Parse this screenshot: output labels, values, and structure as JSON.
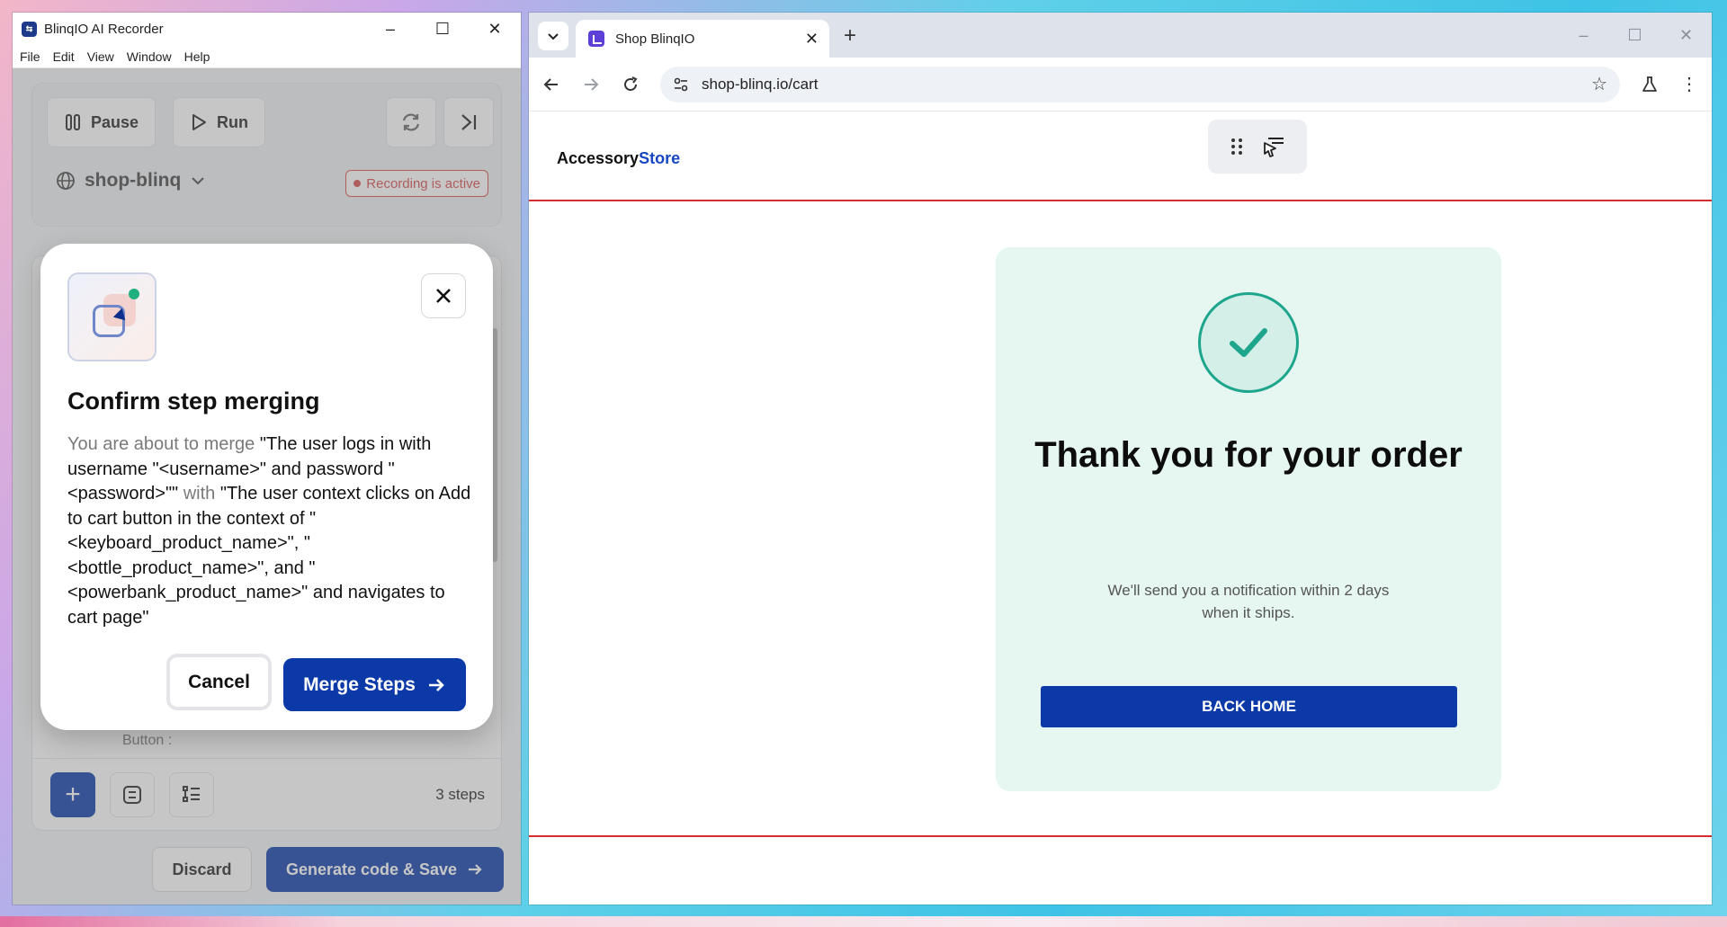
{
  "recorder": {
    "title": "BlinqIO AI Recorder",
    "menu": [
      "File",
      "Edit",
      "View",
      "Window",
      "Help"
    ],
    "pause_label": "Pause",
    "run_label": "Run",
    "site": "shop-blinq",
    "recording_status": "Recording is active",
    "step_ghost": "Button :",
    "steps_count": "3 steps",
    "discard_label": "Discard",
    "generate_label": "Generate code & Save"
  },
  "modal": {
    "title": "Confirm step merging",
    "prefix": "You are about to merge",
    "step_a": "\"The user logs in with username \"<username>\" and password \"<password>\"\"",
    "joiner": "with",
    "step_b": "\"The user context clicks on Add to cart button in the context of \"<keyboard_product_name>\", \"<bottle_product_name>\", and \"<powerbank_product_name>\" and navigates to cart page\"",
    "cancel_label": "Cancel",
    "merge_label": "Merge Steps"
  },
  "browser": {
    "tab_title": "Shop BlinqIO",
    "url": "shop-blinq.io/cart"
  },
  "page": {
    "brand_main": "Accessory",
    "brand_accent": "Store",
    "heading": "Thank you for your order",
    "notice": "We'll send you a notification within 2 days when it ships.",
    "back_home": "BACK HOME"
  },
  "colors": {
    "primary": "#0b3aa8",
    "recording": "#d94b4b",
    "success": "#1ea68d",
    "divider": "#d32f2f"
  }
}
